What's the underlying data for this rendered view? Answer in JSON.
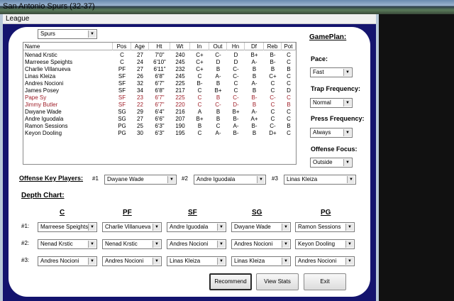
{
  "window": {
    "title": "San Antonio Spurs (32-37)"
  },
  "menu": {
    "league": "League"
  },
  "team_select": "Spurs",
  "table": {
    "columns": [
      "Name",
      "Pos",
      "Age",
      "Ht",
      "Wt",
      "In",
      "Out",
      "Hn",
      "Df",
      "Reb",
      "Pot"
    ],
    "rows": [
      [
        "Nenad Krstic",
        "C",
        "27",
        "7'0\"",
        "240",
        "C+",
        "C-",
        "D",
        "B+",
        "B-",
        "C"
      ],
      [
        "Marreese Speights",
        "C",
        "24",
        "6'10\"",
        "245",
        "C+",
        "D",
        "D",
        "A-",
        "B-",
        "C"
      ],
      [
        "Charlie Villanueva",
        "PF",
        "27",
        "6'11\"",
        "232",
        "C+",
        "B",
        "C-",
        "B",
        "B",
        "B"
      ],
      [
        "Linas Kleiza",
        "SF",
        "26",
        "6'8\"",
        "245",
        "C",
        "A-",
        "C-",
        "B",
        "C+",
        "C"
      ],
      [
        "Andres Nocioni",
        "SF",
        "32",
        "6'7\"",
        "225",
        "B-",
        "B",
        "C",
        "A-",
        "C",
        "C"
      ],
      [
        "James Posey",
        "SF",
        "34",
        "6'8\"",
        "217",
        "C",
        "B+",
        "C",
        "B",
        "C",
        "D"
      ],
      [
        "Pape Sy",
        "SF",
        "23",
        "6'7\"",
        "225",
        "C",
        "B",
        "C-",
        "B-",
        "C-",
        "C"
      ],
      [
        "Jimmy Butler",
        "SF",
        "22",
        "6'7\"",
        "220",
        "C",
        "C-",
        "D-",
        "B",
        "C",
        "B"
      ],
      [
        "Dwyane Wade",
        "SG",
        "29",
        "6'4\"",
        "216",
        "A",
        "B",
        "B+",
        "A-",
        "C",
        "C"
      ],
      [
        "Andre Iguodala",
        "SG",
        "27",
        "6'6\"",
        "207",
        "B+",
        "B",
        "B-",
        "A+",
        "C",
        "C"
      ],
      [
        "Ramon Sessions",
        "PG",
        "25",
        "6'3\"",
        "190",
        "B",
        "C",
        "A-",
        "B-",
        "C-",
        "B"
      ],
      [
        "Keyon Dooling",
        "PG",
        "30",
        "6'3\"",
        "195",
        "C",
        "A-",
        "B-",
        "B",
        "D+",
        "C"
      ]
    ]
  },
  "gameplan": {
    "title": "GamePlan:",
    "pace_label": "Pace:",
    "pace_value": "Fast",
    "trap_label": "Trap Frequency:",
    "trap_value": "Normal",
    "press_label": "Press Frequency:",
    "press_value": "Always",
    "focus_label": "Offense Focus:",
    "focus_value": "Outside"
  },
  "offense": {
    "label": "Offense Key Players:",
    "n1": "#1",
    "p1": "Dwyane Wade",
    "n2": "#2",
    "p2": "Andre Iguodala",
    "n3": "#3",
    "p3": "Linas Kleiza"
  },
  "depth": {
    "title": "Depth Chart:",
    "positions": [
      "C",
      "PF",
      "SF",
      "SG",
      "PG"
    ],
    "row_labels": [
      "#1:",
      "#2:",
      "#3:"
    ],
    "slots": [
      [
        "Marreese Speights",
        "Charlie Villanueva",
        "Andre Iguodala",
        "Dwyane Wade",
        "Ramon Sessions"
      ],
      [
        "Nenad Krstic",
        "Nenad Krstic",
        "Andres Nocioni",
        "Andres Nocioni",
        "Keyon Dooling"
      ],
      [
        "Andres Nocioni",
        "Andres Nocioni",
        "Linas Kleiza",
        "Linas Kleiza",
        "Andres Nocioni"
      ]
    ]
  },
  "buttons": {
    "recommend": "Recommend",
    "view_stats": "View Stats",
    "exit": "Exit"
  },
  "colors": {
    "frame_navy": "#14146e",
    "injured_red": "#a0202a"
  }
}
